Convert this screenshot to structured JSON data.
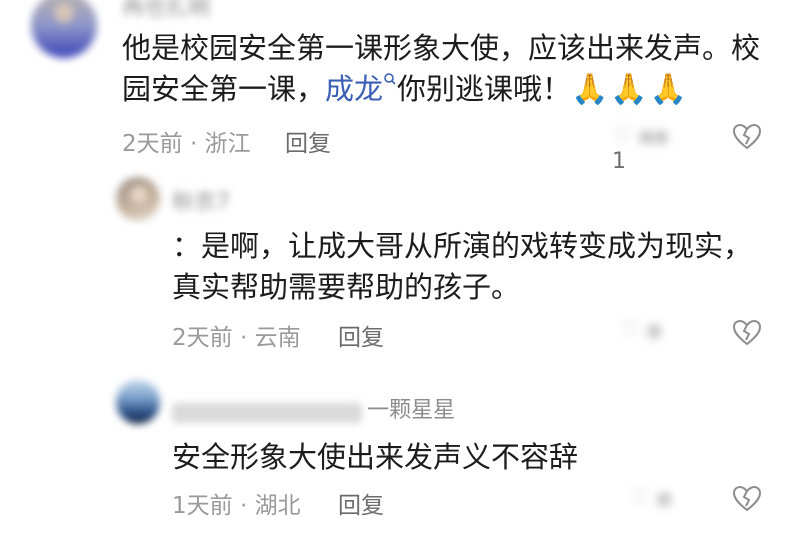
{
  "comments": [
    {
      "username": "冉也扎明",
      "content_line1": "他是校园安全第一课形象大使，应该出来发声。校",
      "content_line2_prefix": "园安全第一课，",
      "mention": "成龙",
      "mention_icon": "search-icon",
      "content_line2_suffix": "你别逃课哦！",
      "emoji": "🙏🙏🙏",
      "date_location": "2天前 · 浙江",
      "reply_label": "回复",
      "like_count": "1",
      "heart_icon": "broken-heart-icon"
    },
    {
      "username": "秋衣7",
      "content_line1": "：是啊，让成大哥从所演的戏转变成为现实，",
      "content_line2": "真实帮助需要帮助的孩子。",
      "date_location": "2天前 · 云南",
      "reply_label": "回复",
      "heart_icon": "broken-heart-icon"
    },
    {
      "username_suffix": "一颗星星",
      "content": "安全形象大使出来发声义不容辞",
      "date_location": "1天前 · 湖北",
      "reply_label": "回复",
      "heart_icon": "broken-heart-icon"
    }
  ]
}
